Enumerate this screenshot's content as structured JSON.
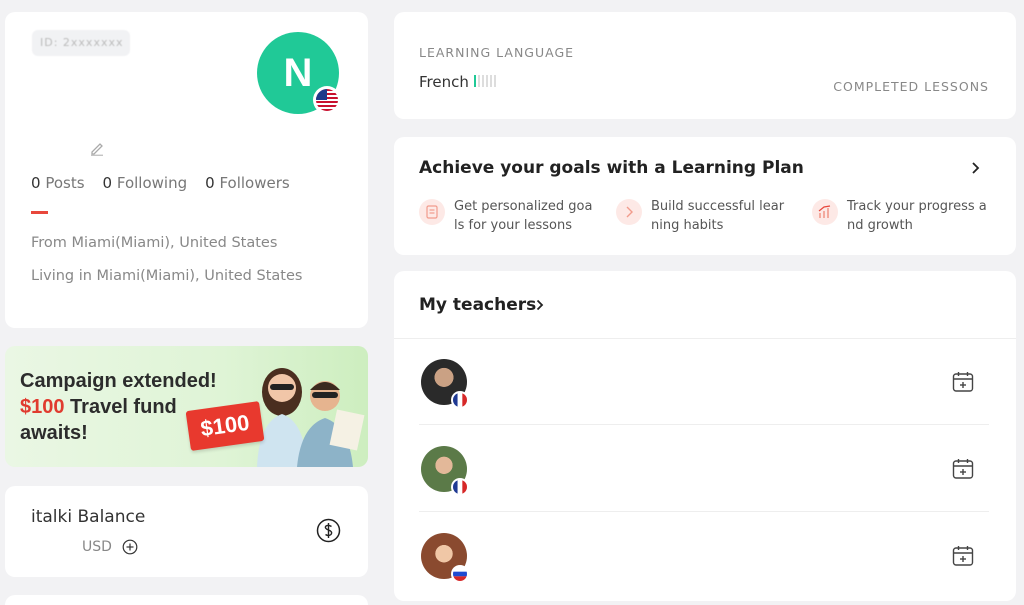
{
  "profile": {
    "id_text": "ID: 2xxxxxxx",
    "avatar_letter": "N",
    "flag": "us-flag-icon",
    "stats": [
      {
        "count": "0",
        "label": "Posts"
      },
      {
        "count": "0",
        "label": "Following"
      },
      {
        "count": "0",
        "label": "Followers"
      }
    ],
    "from": "From Miami(Miami), United States",
    "living": "Living in Miami(Miami), United States"
  },
  "banner": {
    "line1": "Campaign extended!",
    "line2_red": "$100",
    "line2_rest": " Travel fund",
    "line3": "awaits!",
    "price": "$100"
  },
  "balance": {
    "title": "italki Balance",
    "currency": "USD"
  },
  "learning": {
    "label": "LEARNING LANGUAGE",
    "language": "French",
    "completed_label": "COMPLETED LESSONS"
  },
  "plan": {
    "title": "Achieve your goals with a Learning Plan",
    "items": [
      {
        "text": "Get personalized goals for your lessons",
        "icon": "goal-icon"
      },
      {
        "text": "Build successful learning habits",
        "icon": "habit-icon"
      },
      {
        "text": "Track your progress and growth",
        "icon": "progress-icon"
      }
    ]
  },
  "teachers": {
    "title": "My teachers",
    "list": [
      {
        "flag": "fr",
        "avatar_bg": "#2a2a2a"
      },
      {
        "flag": "fr",
        "avatar_bg": "#5b7a48"
      },
      {
        "flag": "ru",
        "avatar_bg": "#a0664a"
      }
    ]
  },
  "colors": {
    "accent_green": "#20c997",
    "accent_red": "#e8473c",
    "background": "#f2f2f4"
  }
}
